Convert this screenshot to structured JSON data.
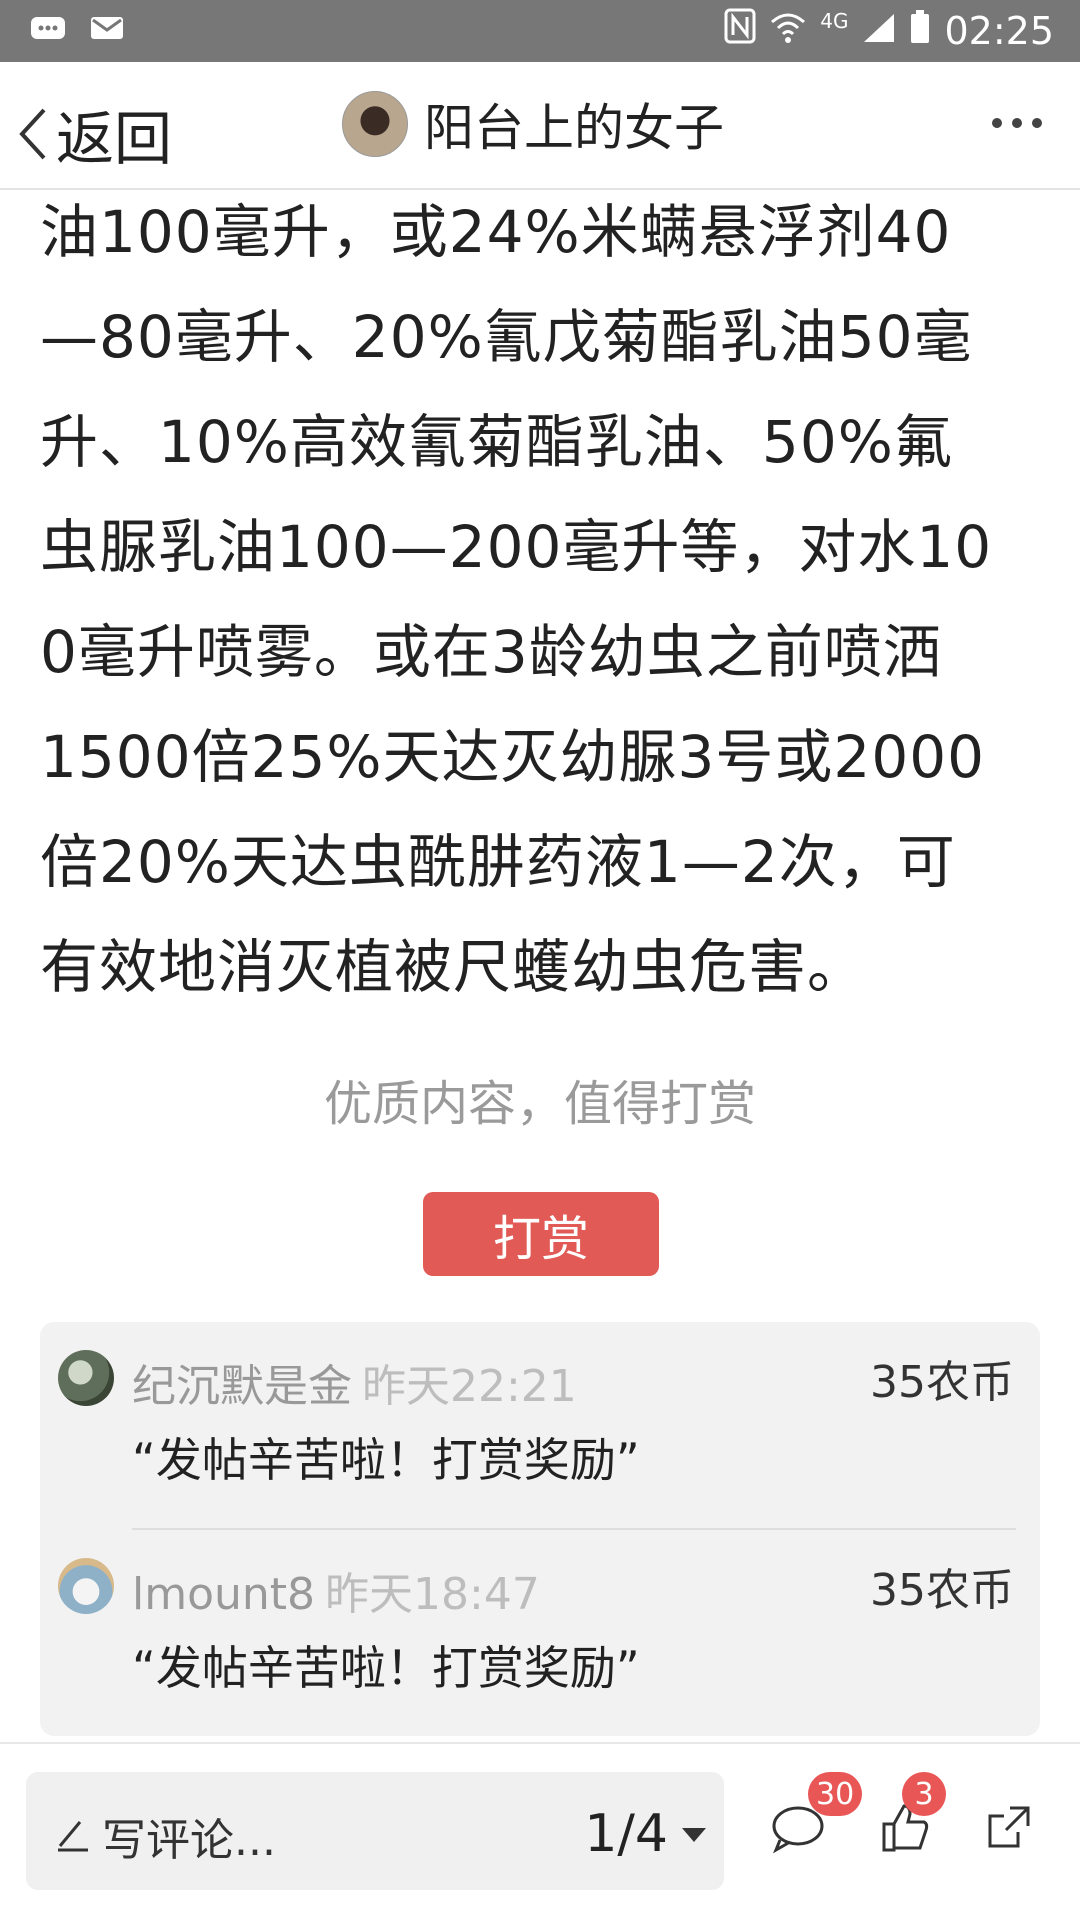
{
  "status_bar": {
    "time": "02:25",
    "network": "4G"
  },
  "header": {
    "back_label": "返回",
    "title": "阳台上的女子"
  },
  "article": {
    "lines": [
      "油100毫升，或24%米螨悬浮剂40",
      "—80毫升、20%氰戊菊酯乳油50毫",
      "升、10%高效氰菊酯乳油、50%氟",
      "虫脲乳油100—200毫升等，对水10",
      "0毫升喷雾。或在3龄幼虫之前喷洒",
      "1500倍25%天达灭幼脲3号或2000",
      "倍20%天达虫酰肼药液1—2次，可",
      "有效地消灭植被尺蠖幼虫危害。"
    ]
  },
  "reward": {
    "prompt": "优质内容，值得打赏",
    "button_label": "打赏",
    "items": [
      {
        "name": "纪沉默是金",
        "time": "昨天22:21",
        "amount": "35农币",
        "message": "“发帖辛苦啦！打赏奖励”"
      },
      {
        "name": "lmount8",
        "time": "昨天18:47",
        "amount": "35农币",
        "message": "“发帖辛苦啦！打赏奖励”"
      }
    ]
  },
  "bottom_bar": {
    "comment_placeholder": "写评论...",
    "page_indicator": "1/4",
    "comments_count": "30",
    "likes_count": "3"
  },
  "colors": {
    "accent_red": "#e25a55",
    "badge_red": "#e95656",
    "status_bar_bg": "#777777"
  }
}
